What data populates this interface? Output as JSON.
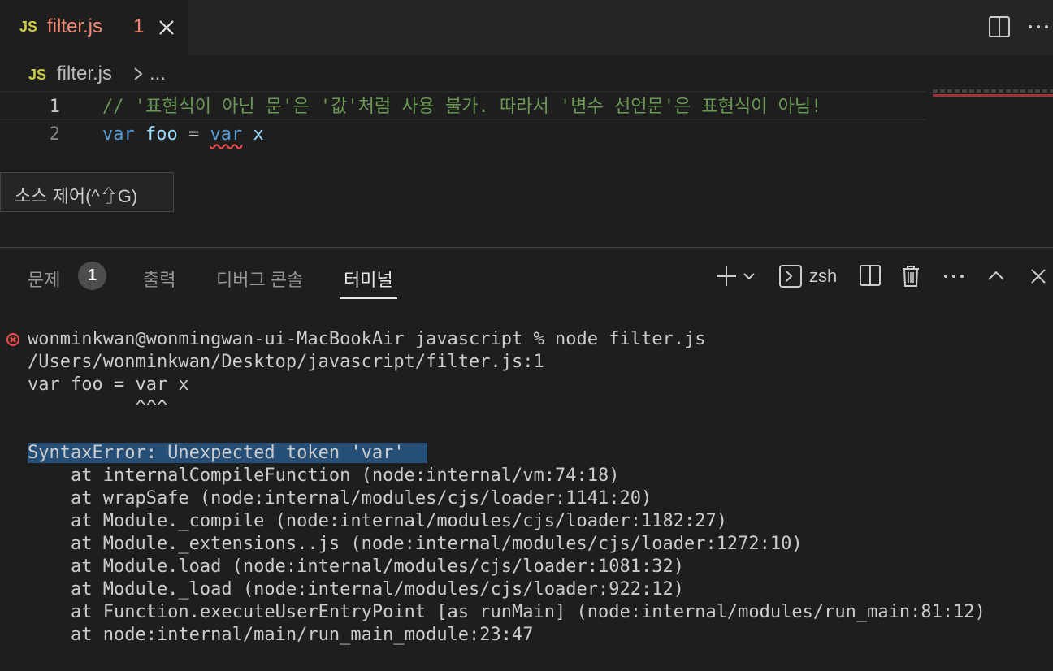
{
  "tab": {
    "language_badge": "JS",
    "title": "filter.js",
    "problem_count": "1"
  },
  "tab_actions": {
    "split_icon": "split-editor-icon",
    "more_icon": "more-actions-icon"
  },
  "breadcrumb": {
    "language_badge": "JS",
    "file": "filter.js",
    "separator": ">",
    "more": "..."
  },
  "editor": {
    "lines": [
      {
        "number": "1",
        "comment": "// '표현식이 아닌 문'은 '값'처럼 사용 불가. 따라서 '변수 선언문'은 표현식이 아님!"
      },
      {
        "number": "2",
        "kw1": "var",
        "ident": "foo",
        "op": "=",
        "kw2": "var",
        "ident2": "x"
      }
    ]
  },
  "tooltip": {
    "text": "소스 제어(^⇧G)"
  },
  "panel": {
    "tabs": [
      {
        "label": "문제",
        "badge": "1",
        "active": false
      },
      {
        "label": "출력",
        "active": false
      },
      {
        "label": "디버그 콘솔",
        "active": false
      },
      {
        "label": "터미널",
        "active": true
      }
    ],
    "shell": "zsh"
  },
  "terminal": {
    "lines": [
      "wonminkwan@wonmingwan-ui-MacBookAir javascript % node filter.js",
      "/Users/wonminkwan/Desktop/javascript/filter.js:1",
      "var foo = var x",
      "          ^^^",
      "",
      "SyntaxError: Unexpected token 'var'",
      "    at internalCompileFunction (node:internal/vm:74:18)",
      "    at wrapSafe (node:internal/modules/cjs/loader:1141:20)",
      "    at Module._compile (node:internal/modules/cjs/loader:1182:27)",
      "    at Module._extensions..js (node:internal/modules/cjs/loader:1272:10)",
      "    at Module.load (node:internal/modules/cjs/loader:1081:32)",
      "    at Module._load (node:internal/modules/cjs/loader:922:12)",
      "    at Function.executeUserEntryPoint [as runMain] (node:internal/modules/run_main:81:12)",
      "    at node:internal/main/run_main_module:23:47"
    ]
  },
  "colors": {
    "error": "#f14c4c",
    "selection": "#264f78",
    "comment": "#6a9955",
    "keyword": "#569cd6"
  }
}
